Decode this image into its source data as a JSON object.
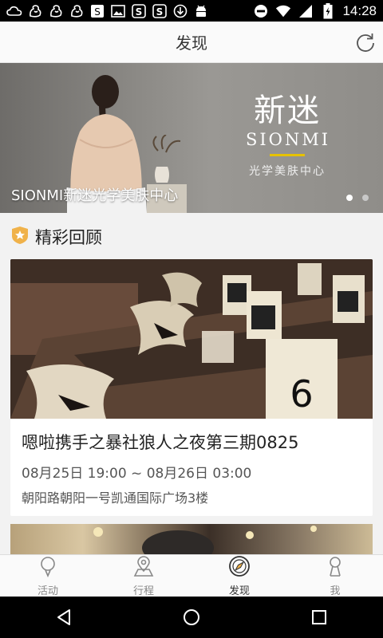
{
  "status_bar": {
    "time": "14:28",
    "icons_left": [
      "weather-icon",
      "squirrel-icon",
      "squirrel-icon",
      "squirrel-icon",
      "sms-icon",
      "image-icon",
      "app-s-icon",
      "app-s-icon",
      "download-icon",
      "android-icon"
    ],
    "icons_right": [
      "do-not-disturb-icon",
      "wifi-icon",
      "signal-icon",
      "battery-charging-icon"
    ]
  },
  "header": {
    "title": "发现",
    "refresh_icon": "refresh-icon"
  },
  "banner": {
    "brand_cn": "新迷",
    "brand_en": "SIONMI",
    "brand_sub": "光学美肤中心",
    "caption": "SIONMI新迷光学美肤中心",
    "page_count": 2,
    "active_index": 0,
    "accent": "#e6c200"
  },
  "section": {
    "title": "精彩回顾",
    "icon": "badge-icon",
    "icon_color": "#f0b24a"
  },
  "cards": [
    {
      "title": "嗯啦携手之暴社狼人之夜第三期0825",
      "time": "08月25日 19:00 ~ 08月26日 03:00",
      "place": "朝阳路朝阳一号凯通国际广场3楼",
      "image_text": "6"
    }
  ],
  "tabs": [
    {
      "label": "活动",
      "icon": "activity-icon",
      "active": false
    },
    {
      "label": "行程",
      "icon": "location-icon",
      "active": false
    },
    {
      "label": "发现",
      "icon": "compass-icon",
      "active": true
    },
    {
      "label": "我",
      "icon": "person-icon",
      "active": false
    }
  ],
  "nav": [
    "back-icon",
    "home-icon",
    "recents-icon"
  ]
}
